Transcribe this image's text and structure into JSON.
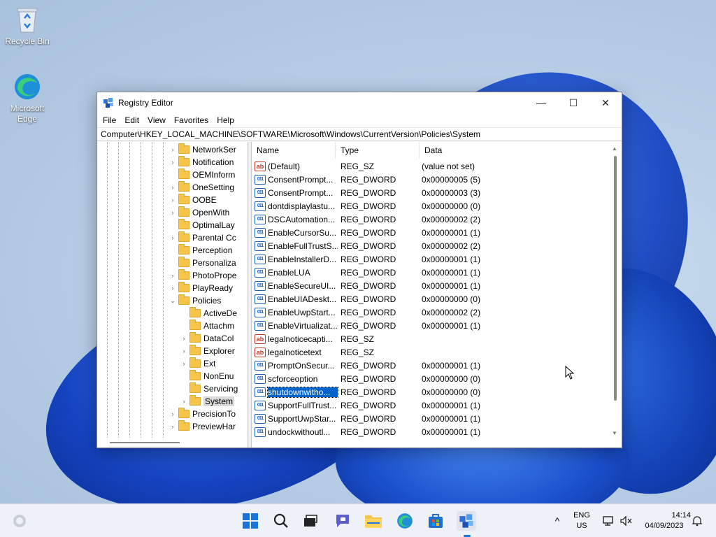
{
  "desktop": {
    "icons": [
      {
        "label": "Recycle Bin"
      },
      {
        "label": "Microsoft Edge"
      }
    ]
  },
  "window": {
    "title": "Registry Editor",
    "menu": [
      "File",
      "Edit",
      "View",
      "Favorites",
      "Help"
    ],
    "address": "Computer\\HKEY_LOCAL_MACHINE\\SOFTWARE\\Microsoft\\Windows\\CurrentVersion\\Policies\\System",
    "controls": {
      "minimize": "—",
      "maximize": "☐",
      "close": "✕"
    }
  },
  "tree": {
    "items": [
      {
        "label": "NetworkSer",
        "expander": "›",
        "level": 0
      },
      {
        "label": "Notification",
        "expander": "›",
        "level": 0
      },
      {
        "label": "OEMInform",
        "expander": "",
        "level": 0
      },
      {
        "label": "OneSetting",
        "expander": "›",
        "level": 0
      },
      {
        "label": "OOBE",
        "expander": "›",
        "level": 0
      },
      {
        "label": "OpenWith",
        "expander": "›",
        "level": 0
      },
      {
        "label": "OptimalLay",
        "expander": "",
        "level": 0
      },
      {
        "label": "Parental Cc",
        "expander": "›",
        "level": 0
      },
      {
        "label": "Perception",
        "expander": "",
        "level": 0
      },
      {
        "label": "Personaliza",
        "expander": "",
        "level": 0
      },
      {
        "label": "PhotoPrope",
        "expander": "›",
        "level": 0
      },
      {
        "label": "PlayReady",
        "expander": "›",
        "level": 0
      },
      {
        "label": "Policies",
        "expander": "⌄",
        "level": 0
      },
      {
        "label": "ActiveDe",
        "expander": "",
        "level": 1
      },
      {
        "label": "Attachm",
        "expander": "",
        "level": 1
      },
      {
        "label": "DataCol",
        "expander": "›",
        "level": 1
      },
      {
        "label": "Explorer",
        "expander": "›",
        "level": 1
      },
      {
        "label": "Ext",
        "expander": "›",
        "level": 1
      },
      {
        "label": "NonEnu",
        "expander": "",
        "level": 1
      },
      {
        "label": "Servicing",
        "expander": "",
        "level": 1
      },
      {
        "label": "System",
        "expander": "›",
        "level": 1,
        "selected": true
      },
      {
        "label": "PrecisionTo",
        "expander": "›",
        "level": 0
      },
      {
        "label": "PreviewHar",
        "expander": "›",
        "level": 0
      }
    ]
  },
  "values": {
    "columns": {
      "name": "Name",
      "type": "Type",
      "data": "Data"
    },
    "rows": [
      {
        "icon": "ab",
        "name": "(Default)",
        "type": "REG_SZ",
        "data": "(value not set)"
      },
      {
        "icon": "dw",
        "name": "ConsentPrompt...",
        "type": "REG_DWORD",
        "data": "0x00000005 (5)"
      },
      {
        "icon": "dw",
        "name": "ConsentPrompt...",
        "type": "REG_DWORD",
        "data": "0x00000003 (3)"
      },
      {
        "icon": "dw",
        "name": "dontdisplaylastu...",
        "type": "REG_DWORD",
        "data": "0x00000000 (0)"
      },
      {
        "icon": "dw",
        "name": "DSCAutomation...",
        "type": "REG_DWORD",
        "data": "0x00000002 (2)"
      },
      {
        "icon": "dw",
        "name": "EnableCursorSu...",
        "type": "REG_DWORD",
        "data": "0x00000001 (1)"
      },
      {
        "icon": "dw",
        "name": "EnableFullTrustS...",
        "type": "REG_DWORD",
        "data": "0x00000002 (2)"
      },
      {
        "icon": "dw",
        "name": "EnableInstallerD...",
        "type": "REG_DWORD",
        "data": "0x00000001 (1)"
      },
      {
        "icon": "dw",
        "name": "EnableLUA",
        "type": "REG_DWORD",
        "data": "0x00000001 (1)"
      },
      {
        "icon": "dw",
        "name": "EnableSecureUI...",
        "type": "REG_DWORD",
        "data": "0x00000001 (1)"
      },
      {
        "icon": "dw",
        "name": "EnableUIADeskt...",
        "type": "REG_DWORD",
        "data": "0x00000000 (0)"
      },
      {
        "icon": "dw",
        "name": "EnableUwpStart...",
        "type": "REG_DWORD",
        "data": "0x00000002 (2)"
      },
      {
        "icon": "dw",
        "name": "EnableVirtualizat...",
        "type": "REG_DWORD",
        "data": "0x00000001 (1)"
      },
      {
        "icon": "ab",
        "name": "legalnoticecapti...",
        "type": "REG_SZ",
        "data": ""
      },
      {
        "icon": "ab",
        "name": "legalnoticetext",
        "type": "REG_SZ",
        "data": ""
      },
      {
        "icon": "dw",
        "name": "PromptOnSecur...",
        "type": "REG_DWORD",
        "data": "0x00000001 (1)"
      },
      {
        "icon": "dw",
        "name": "scforceoption",
        "type": "REG_DWORD",
        "data": "0x00000000 (0)"
      },
      {
        "icon": "dw",
        "name": "shutdownwitho...",
        "type": "REG_DWORD",
        "data": "0x00000000 (0)",
        "selected": true
      },
      {
        "icon": "dw",
        "name": "SupportFullTrust...",
        "type": "REG_DWORD",
        "data": "0x00000001 (1)"
      },
      {
        "icon": "dw",
        "name": "SupportUwpStar...",
        "type": "REG_DWORD",
        "data": "0x00000001 (1)"
      },
      {
        "icon": "dw",
        "name": "undockwithoutl...",
        "type": "REG_DWORD",
        "data": "0x00000001 (1)"
      }
    ]
  },
  "taskbar": {
    "language": {
      "line1": "ENG",
      "line2": "US"
    },
    "time": "14:14",
    "date": "04/09/2023",
    "tray_arrow": "^"
  },
  "colors": {
    "selection": "#0063cc",
    "folder": "#f4c54a"
  }
}
